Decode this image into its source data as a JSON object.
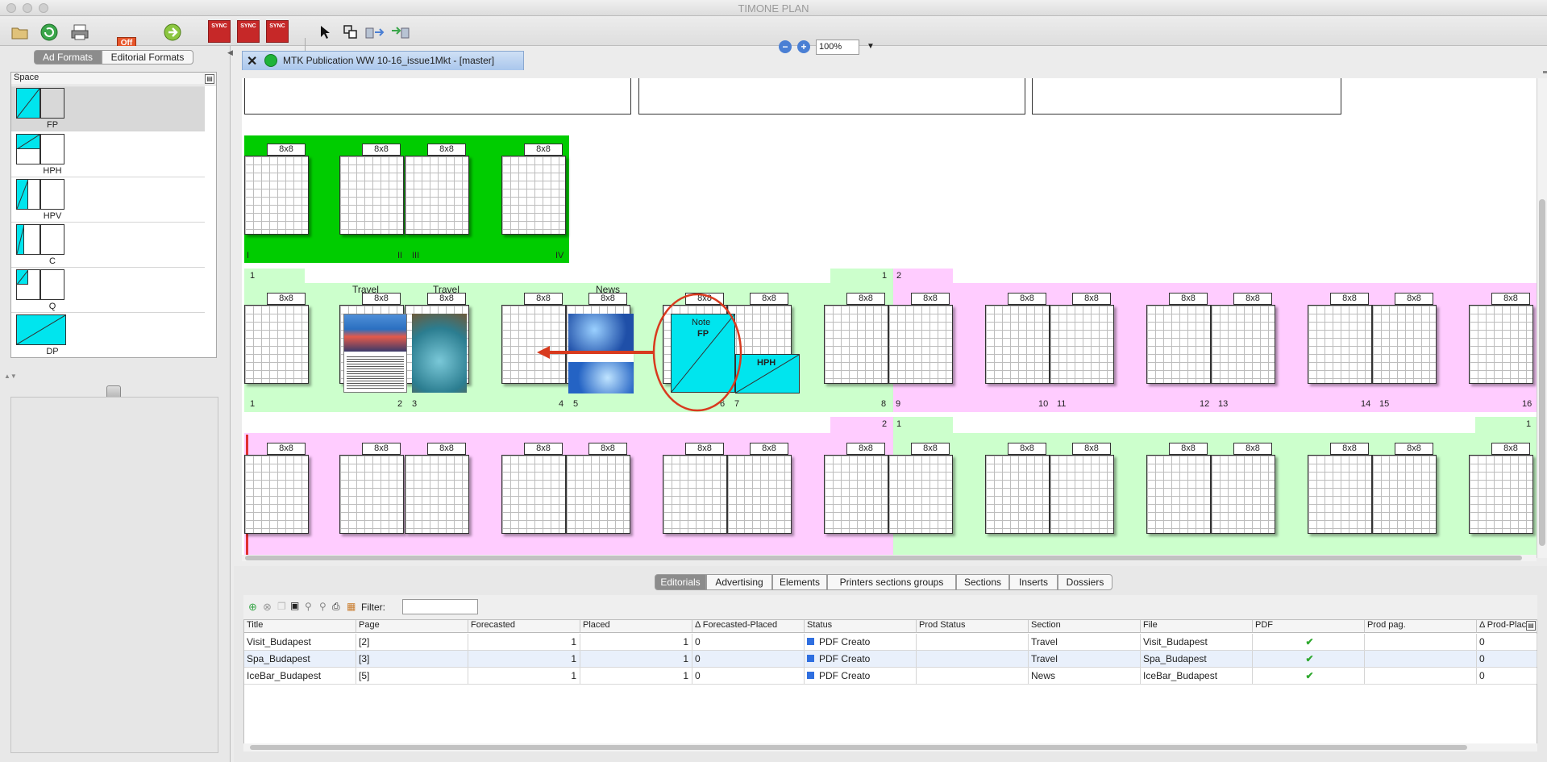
{
  "app": {
    "title": "TIMONE PLAN"
  },
  "toolbar": {
    "off_label": "Off",
    "sync_label": "SYNC",
    "zoom_value": "100%"
  },
  "left_panel": {
    "tabs": [
      "Ad Formats",
      "Editorial Formats"
    ],
    "space_header": "Space",
    "formats": [
      "FP",
      "HPH",
      "HPV",
      "C",
      "Q",
      "DP"
    ]
  },
  "document_tab": {
    "title": "MTK Publication WW 10-16_issue1Mkt - [master]"
  },
  "layout": {
    "page_size": "8x8",
    "row1_pages": [
      "I",
      "II",
      "III",
      "IV"
    ],
    "row2": {
      "signature_left": "1",
      "signature_mid_a": "1",
      "signature_mid_b": "2",
      "sections": [
        "Travel",
        "Travel",
        "News"
      ],
      "page_numbers": [
        "1",
        "2",
        "3",
        "4",
        "5",
        "6",
        "7",
        "8",
        "9",
        "10",
        "11",
        "12",
        "13",
        "14",
        "15",
        "16"
      ],
      "note_label": "Note",
      "fp_label": "FP",
      "hph_label": "HPH"
    },
    "row3": {
      "signature_a": "2",
      "signature_b": "1",
      "signature_c": "1"
    }
  },
  "bottom_tabs": [
    "Editorials",
    "Advertising",
    "Elements",
    "Printers sections groups",
    "Sections",
    "Inserts",
    "Dossiers"
  ],
  "filter": {
    "label": "Filter:",
    "value": ""
  },
  "table": {
    "columns": [
      "Title",
      "Page",
      "Forecasted",
      "Placed",
      "Δ Forecasted-Placed",
      "Status",
      "Prod Status",
      "Section",
      "File",
      "PDF",
      "Prod pag.",
      "Δ Prod-Plac"
    ],
    "rows": [
      {
        "title": "Visit_Budapest",
        "page": "[2]",
        "forecasted": "1",
        "placed": "1",
        "delta": "0",
        "status": "PDF Creato",
        "prod_status": "",
        "section": "Travel",
        "file": "Visit_Budapest",
        "pdf": "✔",
        "prod_pag": "",
        "delta_prod": "0"
      },
      {
        "title": "Spa_Budapest",
        "page": "[3]",
        "forecasted": "1",
        "placed": "1",
        "delta": "0",
        "status": "PDF Creato",
        "prod_status": "",
        "section": "Travel",
        "file": "Spa_Budapest",
        "pdf": "✔",
        "prod_pag": "",
        "delta_prod": "0"
      },
      {
        "title": "IceBar_Budapest",
        "page": "[5]",
        "forecasted": "1",
        "placed": "1",
        "delta": "0",
        "status": "PDF Creato",
        "prod_status": "",
        "section": "News",
        "file": "IceBar_Budapest",
        "pdf": "✔",
        "prod_pag": "",
        "delta_prod": "0"
      }
    ]
  },
  "colors": {
    "green_signature": "#00cc00",
    "light_green": "#ccffcc",
    "light_pink": "#ffccff",
    "cyan_format": "#00e5ee",
    "status_blue": "#2f6fe0",
    "annotation_red": "#d83a1e"
  }
}
